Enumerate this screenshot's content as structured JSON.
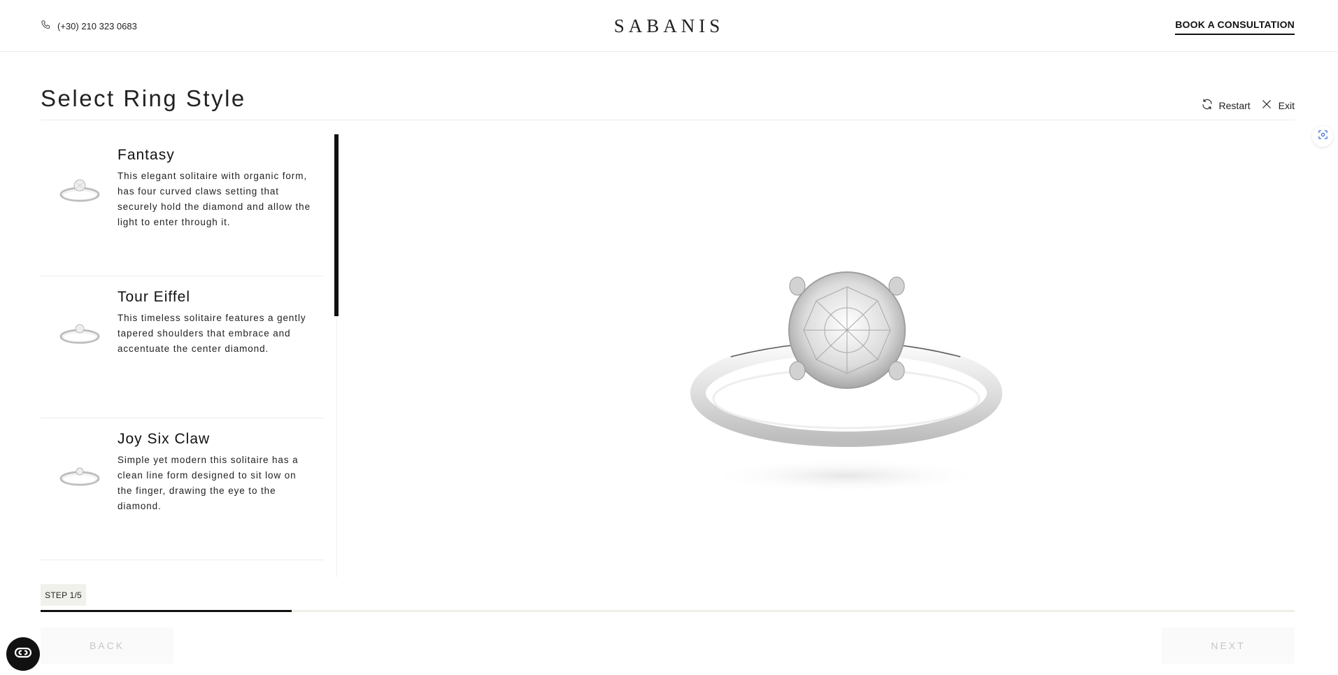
{
  "header": {
    "phone": "(+30) 210 323 0683",
    "logo": "SABANIS",
    "cta_label": "BOOK A CONSULTATION"
  },
  "page": {
    "title": "Select Ring Style",
    "restart_label": "Restart",
    "exit_label": "Exit"
  },
  "styles": [
    {
      "title": "Fantasy",
      "description": "This elegant solitaire with organic form, has four curved claws setting that securely hold the diamond and allow the light to enter through it."
    },
    {
      "title": "Tour Eiffel",
      "description": "This timeless solitaire features a gently tapered shoulders that embrace and accentuate the center diamond."
    },
    {
      "title": "Joy Six Claw",
      "description": "Simple yet modern this solitaire has a clean line form designed to sit low on the finger, drawing the eye to the diamond."
    }
  ],
  "progress": {
    "step_label": "STEP 1/5",
    "fraction": 0.2
  },
  "nav": {
    "back_label": "BACK",
    "next_label": "NEXT"
  },
  "colors": {
    "accent": "#111111",
    "progress_track": "#efefe8",
    "disabled_text": "#c6c6c6"
  },
  "icons": {
    "phone": "phone-icon",
    "restart": "restart-icon",
    "exit": "close-icon",
    "scan": "scan-icon",
    "accessibility": "accessibility-icon"
  }
}
